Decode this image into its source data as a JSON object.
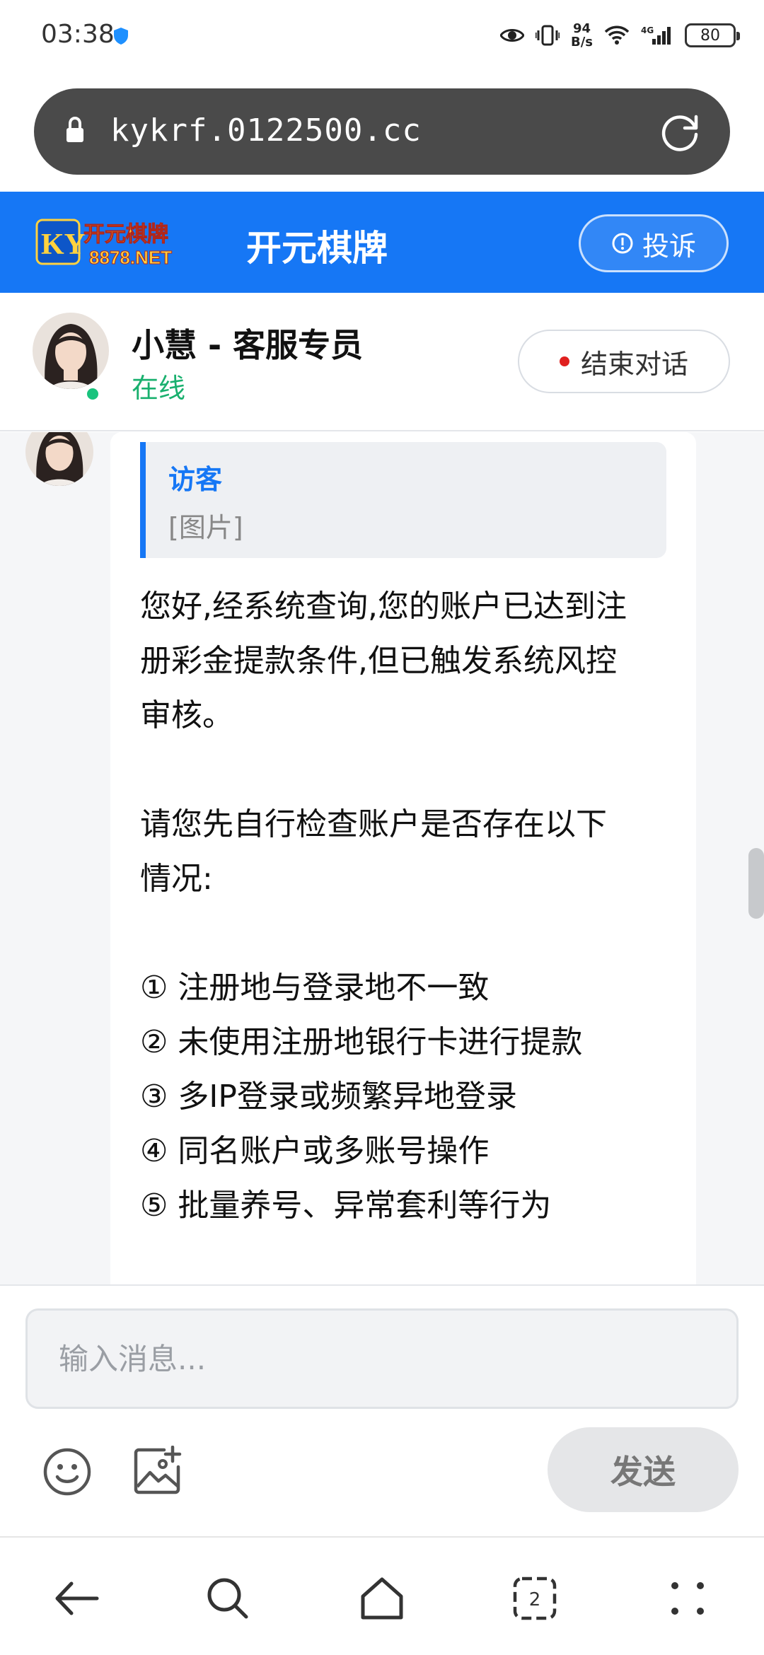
{
  "status_bar": {
    "time": "03:38",
    "net_speed_value": "94",
    "net_speed_unit": "B/s",
    "network_type": "4G",
    "battery": "80"
  },
  "browser": {
    "url": "kykrf.0122500.cc",
    "tab_count": "2"
  },
  "site_header": {
    "logo_top": "开元棋牌",
    "logo_bottom": "8878.NET",
    "logo_mark": "KY",
    "title": "开元棋牌",
    "complaint_label": "投诉",
    "brand_color": "#1677f5"
  },
  "agent": {
    "name": "小慧 - 客服专员",
    "status": "在线",
    "end_chat_label": "结束对话"
  },
  "message": {
    "quote_author": "访客",
    "quote_text": "[图片]",
    "lines": [
      "您好,经系统查询,您的账户已达到注",
      "册彩金提款条件,但已触发系统风控",
      "审核。",
      "",
      "请您先自行检查账户是否存在以下",
      "情况:",
      "",
      "① 注册地与登录地不一致",
      "② 未使用注册地银行卡进行提款",
      "③ 多IP登录或频繁异地登录",
      "④ 同名账户或多账号操作",
      "⑤ 批量养号、异常套利等行为"
    ]
  },
  "composer": {
    "placeholder": "输入消息...",
    "send_label": "发送"
  }
}
